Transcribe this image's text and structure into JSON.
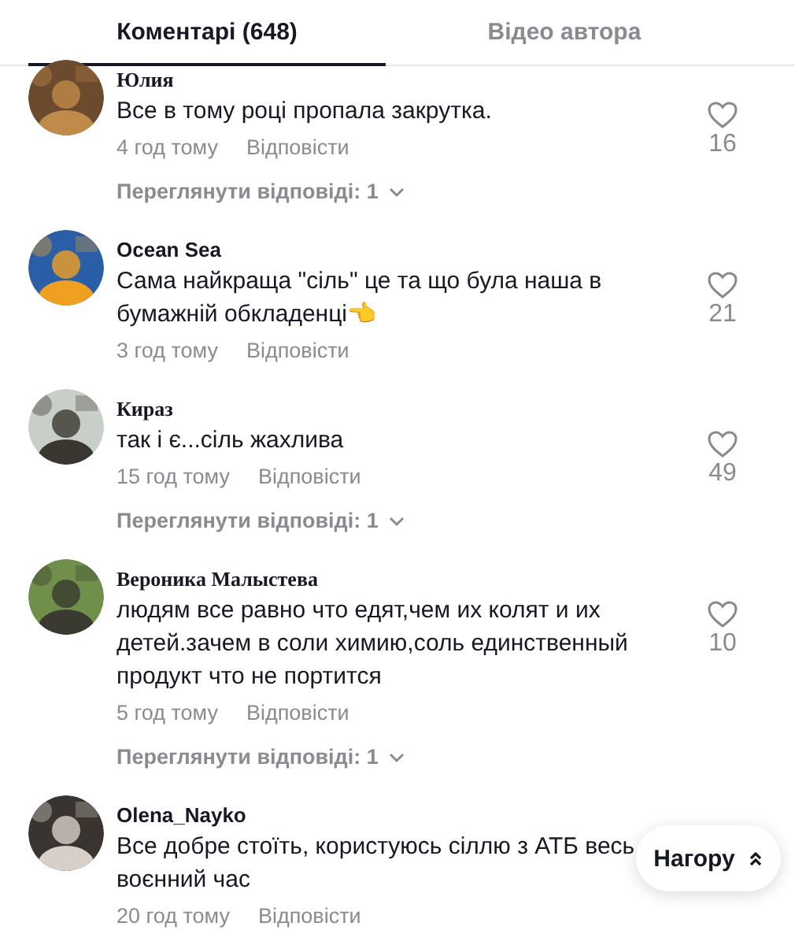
{
  "tabs": [
    {
      "label": "Коментарі (648)",
      "selected": true
    },
    {
      "label": "Відео автора",
      "selected": false
    }
  ],
  "comments": [
    {
      "author": "Юлия",
      "kind": "serif",
      "text": "Все в тому році пропала закрутка.",
      "time": "4 год тому",
      "reply": "Відповісти",
      "likes": "16",
      "replies": "Переглянути відповіді: 1"
    },
    {
      "author": "Ocean Sea",
      "kind": "sans",
      "text": "Сама найкраща \"сіль\" це та що була наша в бумажній обкладенці👈",
      "time": "3 год тому",
      "reply": "Відповісти",
      "likes": "21"
    },
    {
      "author": "Кираз",
      "kind": "serif",
      "text": "так і є...сіль жахлива",
      "time": "15 год тому",
      "reply": "Відповісти",
      "likes": "49",
      "replies": "Переглянути відповіді: 1"
    },
    {
      "author": "Вероника Малыстева",
      "kind": "serif",
      "text": "людям все равно что едят,чем их колят и их детей.зачем в соли химию,соль единственный продукт что не портится",
      "time": "5 год тому",
      "reply": "Відповісти",
      "likes": "10",
      "replies": "Переглянути відповіді: 1"
    },
    {
      "author": "Olena_Nayko",
      "kind": "sans",
      "text": "Все добре стоїть, користуюсь сіллю з АТБ весь воєнний час",
      "time": "20 год тому",
      "reply": "Відповісти"
    }
  ],
  "back_to_top": {
    "label": "Нагору"
  }
}
